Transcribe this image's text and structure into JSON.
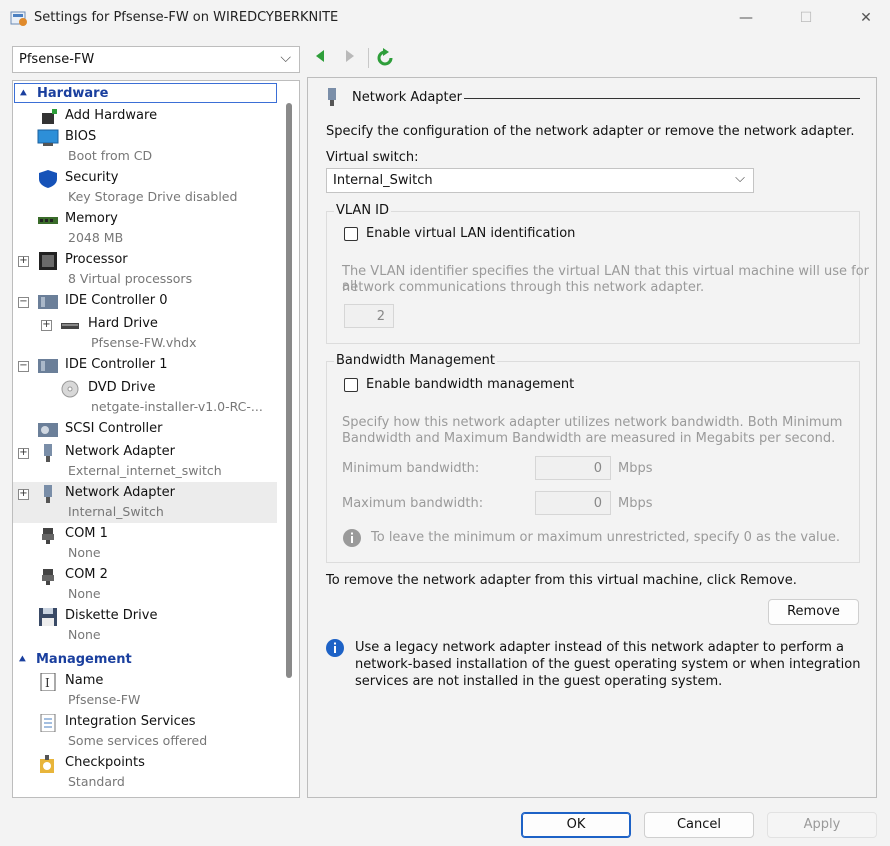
{
  "window": {
    "title": "Settings for Pfsense-FW on WIREDCYBERKNITE",
    "minimize_glyph": "—",
    "maximize_glyph": "☐",
    "close_glyph": "✕"
  },
  "vm_selector": {
    "value": "Pfsense-FW",
    "chevron": "⌵"
  },
  "tree": {
    "hardware_header": "Hardware",
    "management_header": "Management",
    "items": [
      {
        "label": "Add Hardware",
        "sub": "",
        "icon": "add-hardware-icon"
      },
      {
        "label": "BIOS",
        "sub": "Boot from CD",
        "icon": "bios-icon"
      },
      {
        "label": "Security",
        "sub": "Key Storage Drive disabled",
        "icon": "shield-icon"
      },
      {
        "label": "Memory",
        "sub": "2048 MB",
        "icon": "memory-icon"
      },
      {
        "label": "Processor",
        "sub": "8 Virtual processors",
        "icon": "processor-icon"
      },
      {
        "label": "IDE Controller 0",
        "sub": "",
        "icon": "ide-controller-icon"
      },
      {
        "label": "Hard Drive",
        "sub": "Pfsense-FW.vhdx",
        "icon": "hard-drive-icon"
      },
      {
        "label": "IDE Controller 1",
        "sub": "",
        "icon": "ide-controller-icon"
      },
      {
        "label": "DVD Drive",
        "sub": "netgate-installer-v1.0-RC-...",
        "icon": "dvd-drive-icon"
      },
      {
        "label": "SCSI Controller",
        "sub": "",
        "icon": "scsi-controller-icon"
      },
      {
        "label": "Network Adapter",
        "sub": "External_internet_switch",
        "icon": "network-adapter-icon"
      },
      {
        "label": "Network Adapter",
        "sub": "Internal_Switch",
        "icon": "network-adapter-icon"
      },
      {
        "label": "COM 1",
        "sub": "None",
        "icon": "com-port-icon"
      },
      {
        "label": "COM 2",
        "sub": "None",
        "icon": "com-port-icon"
      },
      {
        "label": "Diskette Drive",
        "sub": "None",
        "icon": "floppy-icon"
      }
    ],
    "management_items": [
      {
        "label": "Name",
        "sub": "Pfsense-FW",
        "icon": "name-icon"
      },
      {
        "label": "Integration Services",
        "sub": "Some services offered",
        "icon": "integration-services-icon"
      },
      {
        "label": "Checkpoints",
        "sub": "Standard",
        "icon": "checkpoints-icon"
      }
    ]
  },
  "panel": {
    "title": "Network Adapter",
    "intro": "Specify the configuration of the network adapter or remove the network adapter.",
    "virtual_switch_label": "Virtual switch:",
    "virtual_switch_value": "Internal_Switch",
    "vlan": {
      "group_title": "VLAN ID",
      "checkbox_label": "Enable virtual LAN identification",
      "desc_line1": "The VLAN identifier specifies the virtual LAN that this virtual machine will use for all",
      "desc_line2": "network communications through this network adapter.",
      "value": "2"
    },
    "bandwidth": {
      "group_title": "Bandwidth Management",
      "checkbox_label": "Enable bandwidth management",
      "desc_line1": "Specify how this network adapter utilizes network bandwidth. Both Minimum",
      "desc_line2": "Bandwidth and Maximum Bandwidth are measured in Megabits per second.",
      "min_label": "Minimum bandwidth:",
      "min_value": "0",
      "max_label": "Maximum bandwidth:",
      "max_value": "0",
      "unit": "Mbps",
      "hint": "To leave the minimum or maximum unrestricted, specify 0 as the value."
    },
    "remove_text": "To remove the network adapter from this virtual machine, click Remove.",
    "remove_button": "Remove",
    "legacy_line1": "Use a legacy network adapter instead of this network adapter to perform a",
    "legacy_line2": "network-based installation of the guest operating system or when integration",
    "legacy_line3": "services are not installed in the guest operating system."
  },
  "footer": {
    "ok": "OK",
    "cancel": "Cancel",
    "apply": "Apply"
  },
  "colors": {
    "accent": "#1d62c6",
    "header_blue": "#1a3f9e",
    "nav_green": "#2e9e3a",
    "selected_row": "#ececec"
  }
}
